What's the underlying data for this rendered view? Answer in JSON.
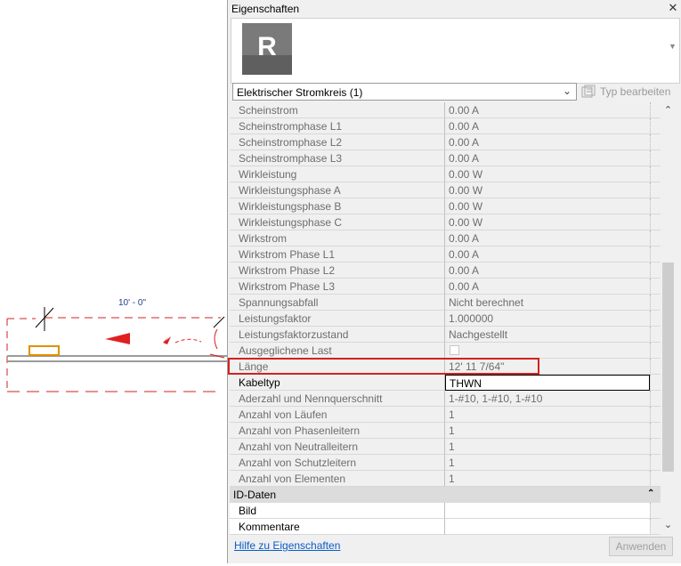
{
  "canvas": {
    "dimension_label": "10' - 0\""
  },
  "panel": {
    "title": "Eigenschaften",
    "close_icon": "close-icon",
    "logo_letter": "R",
    "type_selector": "Elektrischer Stromkreis (1)",
    "edit_type": "Typ bearbeiten",
    "rows": [
      {
        "label": "Scheinstrom",
        "value": "0.00 A"
      },
      {
        "label": "Scheinstromphase L1",
        "value": "0.00 A"
      },
      {
        "label": "Scheinstromphase L2",
        "value": "0.00 A"
      },
      {
        "label": "Scheinstromphase L3",
        "value": "0.00 A"
      },
      {
        "label": "Wirkleistung",
        "value": "0.00 W"
      },
      {
        "label": "Wirkleistungsphase A",
        "value": "0.00 W"
      },
      {
        "label": "Wirkleistungsphase B",
        "value": "0.00 W"
      },
      {
        "label": "Wirkleistungsphase C",
        "value": "0.00 W"
      },
      {
        "label": "Wirkstrom",
        "value": "0.00 A"
      },
      {
        "label": "Wirkstrom Phase L1",
        "value": "0.00 A"
      },
      {
        "label": "Wirkstrom Phase L2",
        "value": "0.00 A"
      },
      {
        "label": "Wirkstrom Phase L3",
        "value": "0.00 A"
      },
      {
        "label": "Spannungsabfall",
        "value": "Nicht berechnet"
      },
      {
        "label": "Leistungsfaktor",
        "value": "1.000000"
      },
      {
        "label": "Leistungsfaktorzustand",
        "value": "Nachgestellt"
      },
      {
        "label": "Ausgeglichene Last",
        "value": ""
      },
      {
        "label": "Länge",
        "value": "12'  11 7/64\""
      },
      {
        "label": "Kabeltyp",
        "value": "THWN"
      },
      {
        "label": "Aderzahl und Nennquerschnitt",
        "value": "1-#10, 1-#10, 1-#10"
      },
      {
        "label": "Anzahl von Läufen",
        "value": "1"
      },
      {
        "label": "Anzahl von Phasenleitern",
        "value": "1"
      },
      {
        "label": "Anzahl von Neutralleitern",
        "value": "1"
      },
      {
        "label": "Anzahl von Schutzleitern",
        "value": "1"
      },
      {
        "label": "Anzahl von Elementen",
        "value": "1"
      }
    ],
    "group_label": "ID-Daten",
    "group_rows": [
      {
        "label": "Bild",
        "value": ""
      },
      {
        "label": "Kommentare",
        "value": ""
      }
    ],
    "help_link": "Hilfe zu Eigenschaften",
    "apply_button": "Anwenden"
  },
  "colors": {
    "highlight": "#d62020",
    "link": "#0b5cc6",
    "group_bg": "#dcdcdc"
  }
}
